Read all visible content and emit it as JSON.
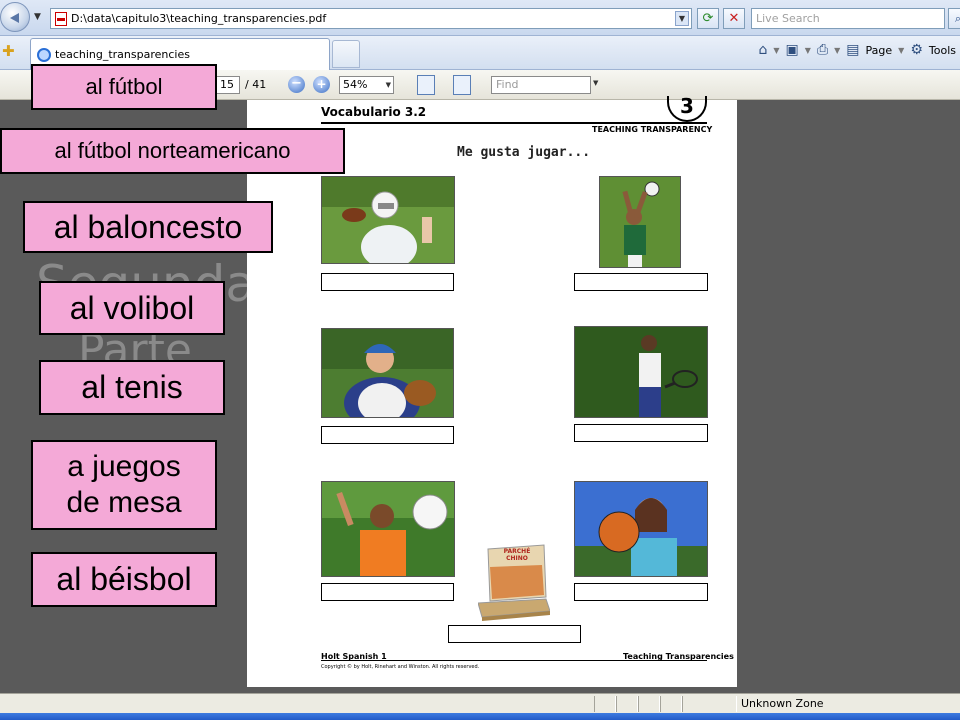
{
  "browser": {
    "address": "D:\\data\\capitulo3\\teaching_transparencies.pdf",
    "search_placeholder": "Live Search",
    "tab_title": "teaching_transparencies",
    "page_menu": "Page",
    "tools_menu": "Tools"
  },
  "pdf_toolbar": {
    "current_page": "15",
    "total_pages": "/ 41",
    "zoom": "54%",
    "find_placeholder": "Find"
  },
  "background_slide": {
    "title": "Segunda",
    "subtitle": "Parte"
  },
  "pdf_page": {
    "header": "Vocabulario 3.2",
    "chapter_number": "3",
    "badge_label": "TEACHING TRANSPARENCY",
    "subtitle": "Me gusta jugar...",
    "game_box_title": "PARCHÉ CHINO",
    "footer_left": "Holt Spanish 1",
    "footer_right": "Teaching Transparencies",
    "copyright": "Copyright © by Holt, Rinehart and Winston. All rights reserved."
  },
  "labels": {
    "futbol": "al fútbol",
    "futbol_americano": "al fútbol norteamericano",
    "baloncesto": "al baloncesto",
    "volibol": "al volibol",
    "tenis": "al tenis",
    "juegos_mesa": "a juegos de mesa",
    "beisbol": "al béisbol"
  },
  "status": {
    "zone": "Unknown Zone"
  },
  "colors": {
    "label_pink": "#f4a9d7",
    "viewer_gray": "#5a5a5a"
  }
}
